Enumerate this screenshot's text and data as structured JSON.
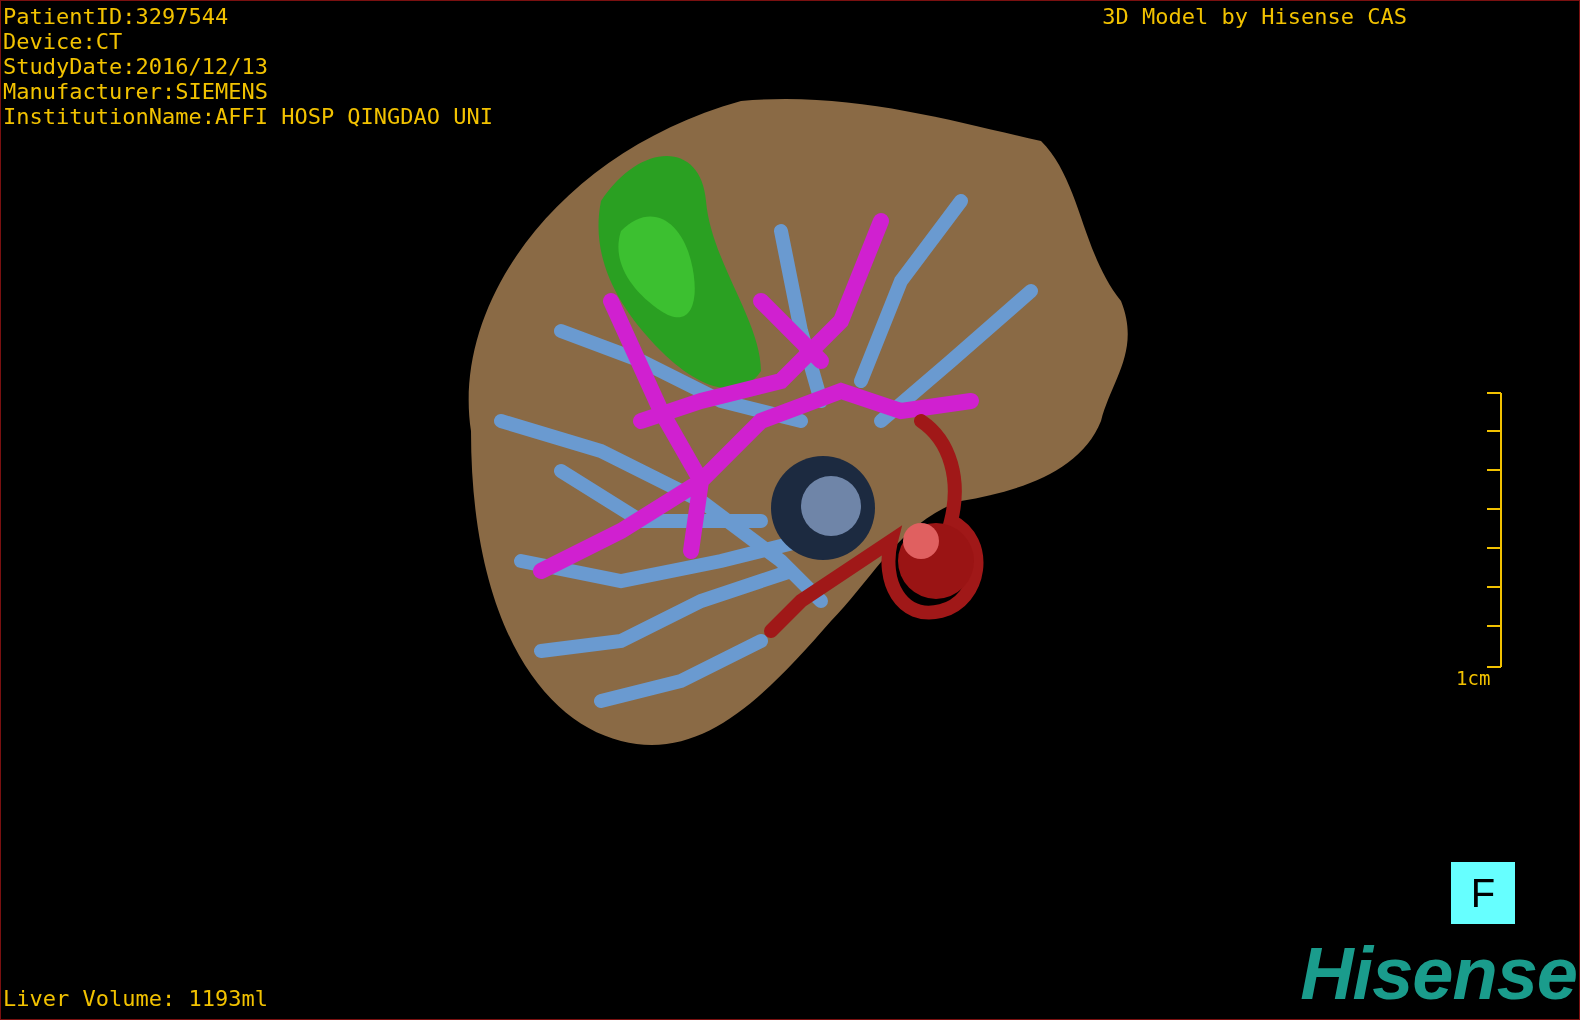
{
  "viewport": {
    "info_lines": [
      "PatientID:3297544",
      "Device:CT",
      "StudyDate:2016/12/13",
      "Manufacturer:SIEMENS",
      "InstitutionName:AFFI HOSP QINGDAO UNI"
    ],
    "credit": "3D Model by Hisense CAS",
    "scale_bar": {
      "label": "1cm"
    },
    "orientation": "F",
    "logo": "Hisense",
    "volume": "Liver Volume: 1193ml"
  }
}
